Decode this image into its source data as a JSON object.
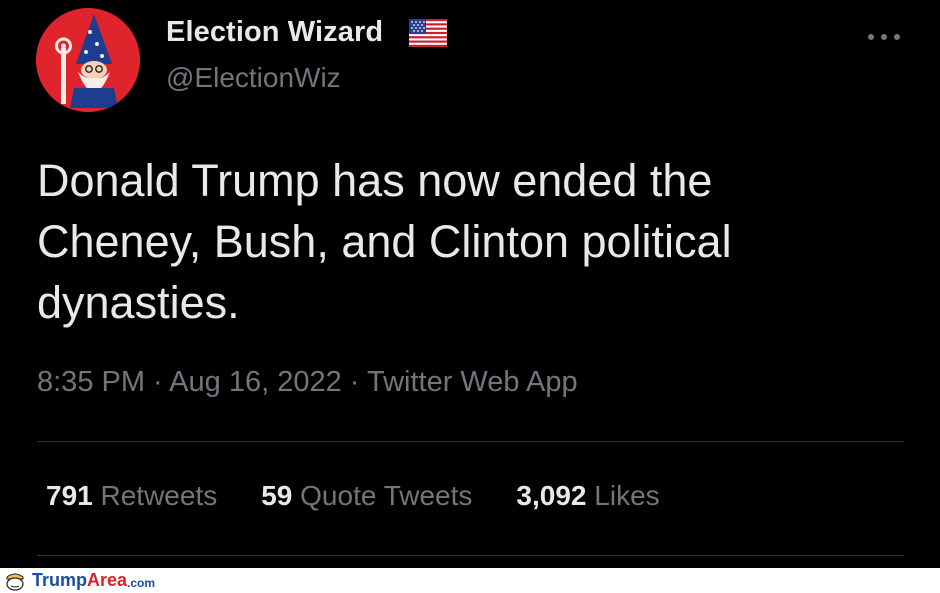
{
  "user": {
    "display_name": "Election Wizard",
    "handle": "@ElectionWiz",
    "avatar_icon": "wizard-avatar-icon",
    "flag_icon": "us-flag-icon",
    "avatar_bg": "#e0242b"
  },
  "more_icon": "more-dots-icon",
  "tweet": {
    "text": "Donald Trump has now ended the\nCheney, Bush, and Clinton political\ndynasties."
  },
  "meta": {
    "time": "8:35 PM",
    "sep1": " · ",
    "date": "Aug 16, 2022",
    "sep2": " · ",
    "source": "Twitter Web App"
  },
  "stats": {
    "retweets": {
      "count": "791",
      "label": "Retweets"
    },
    "quotes": {
      "count": "59",
      "label": "Quote Tweets"
    },
    "likes": {
      "count": "3,092",
      "label": "Likes"
    }
  },
  "footer": {
    "brand_part1": "Trump",
    "brand_part2": "Area",
    "brand_part3": ".com",
    "logo_icon": "trump-area-logo-icon"
  },
  "colors": {
    "background": "#000000",
    "text_primary": "#e7e9ea",
    "text_secondary": "#71767b",
    "divider": "#2f3336",
    "brand_blue": "#1a4fa0",
    "brand_red": "#d9232a"
  }
}
